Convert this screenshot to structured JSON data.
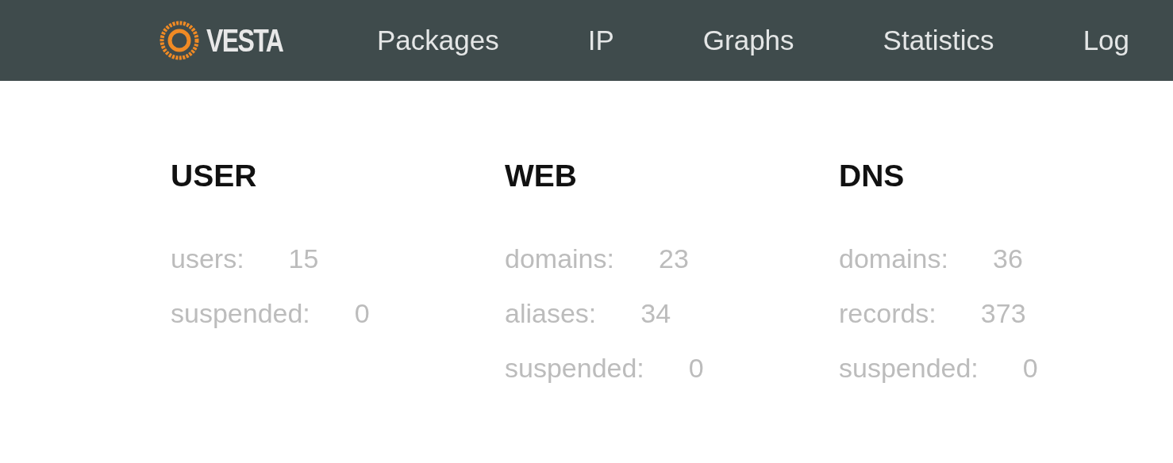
{
  "logo": {
    "text": "VESTA"
  },
  "nav": [
    {
      "label": "Packages"
    },
    {
      "label": "IP"
    },
    {
      "label": "Graphs"
    },
    {
      "label": "Statistics"
    },
    {
      "label": "Log"
    }
  ],
  "sections": [
    {
      "title": "USER",
      "stats": [
        {
          "label": "users:",
          "value": "15"
        },
        {
          "label": "suspended:",
          "value": "0"
        }
      ]
    },
    {
      "title": "WEB",
      "stats": [
        {
          "label": "domains:",
          "value": "23"
        },
        {
          "label": "aliases:",
          "value": "34"
        },
        {
          "label": "suspended:",
          "value": "0"
        }
      ]
    },
    {
      "title": "DNS",
      "stats": [
        {
          "label": "domains:",
          "value": "36"
        },
        {
          "label": "records:",
          "value": "373"
        },
        {
          "label": "suspended:",
          "value": "0"
        }
      ]
    }
  ]
}
